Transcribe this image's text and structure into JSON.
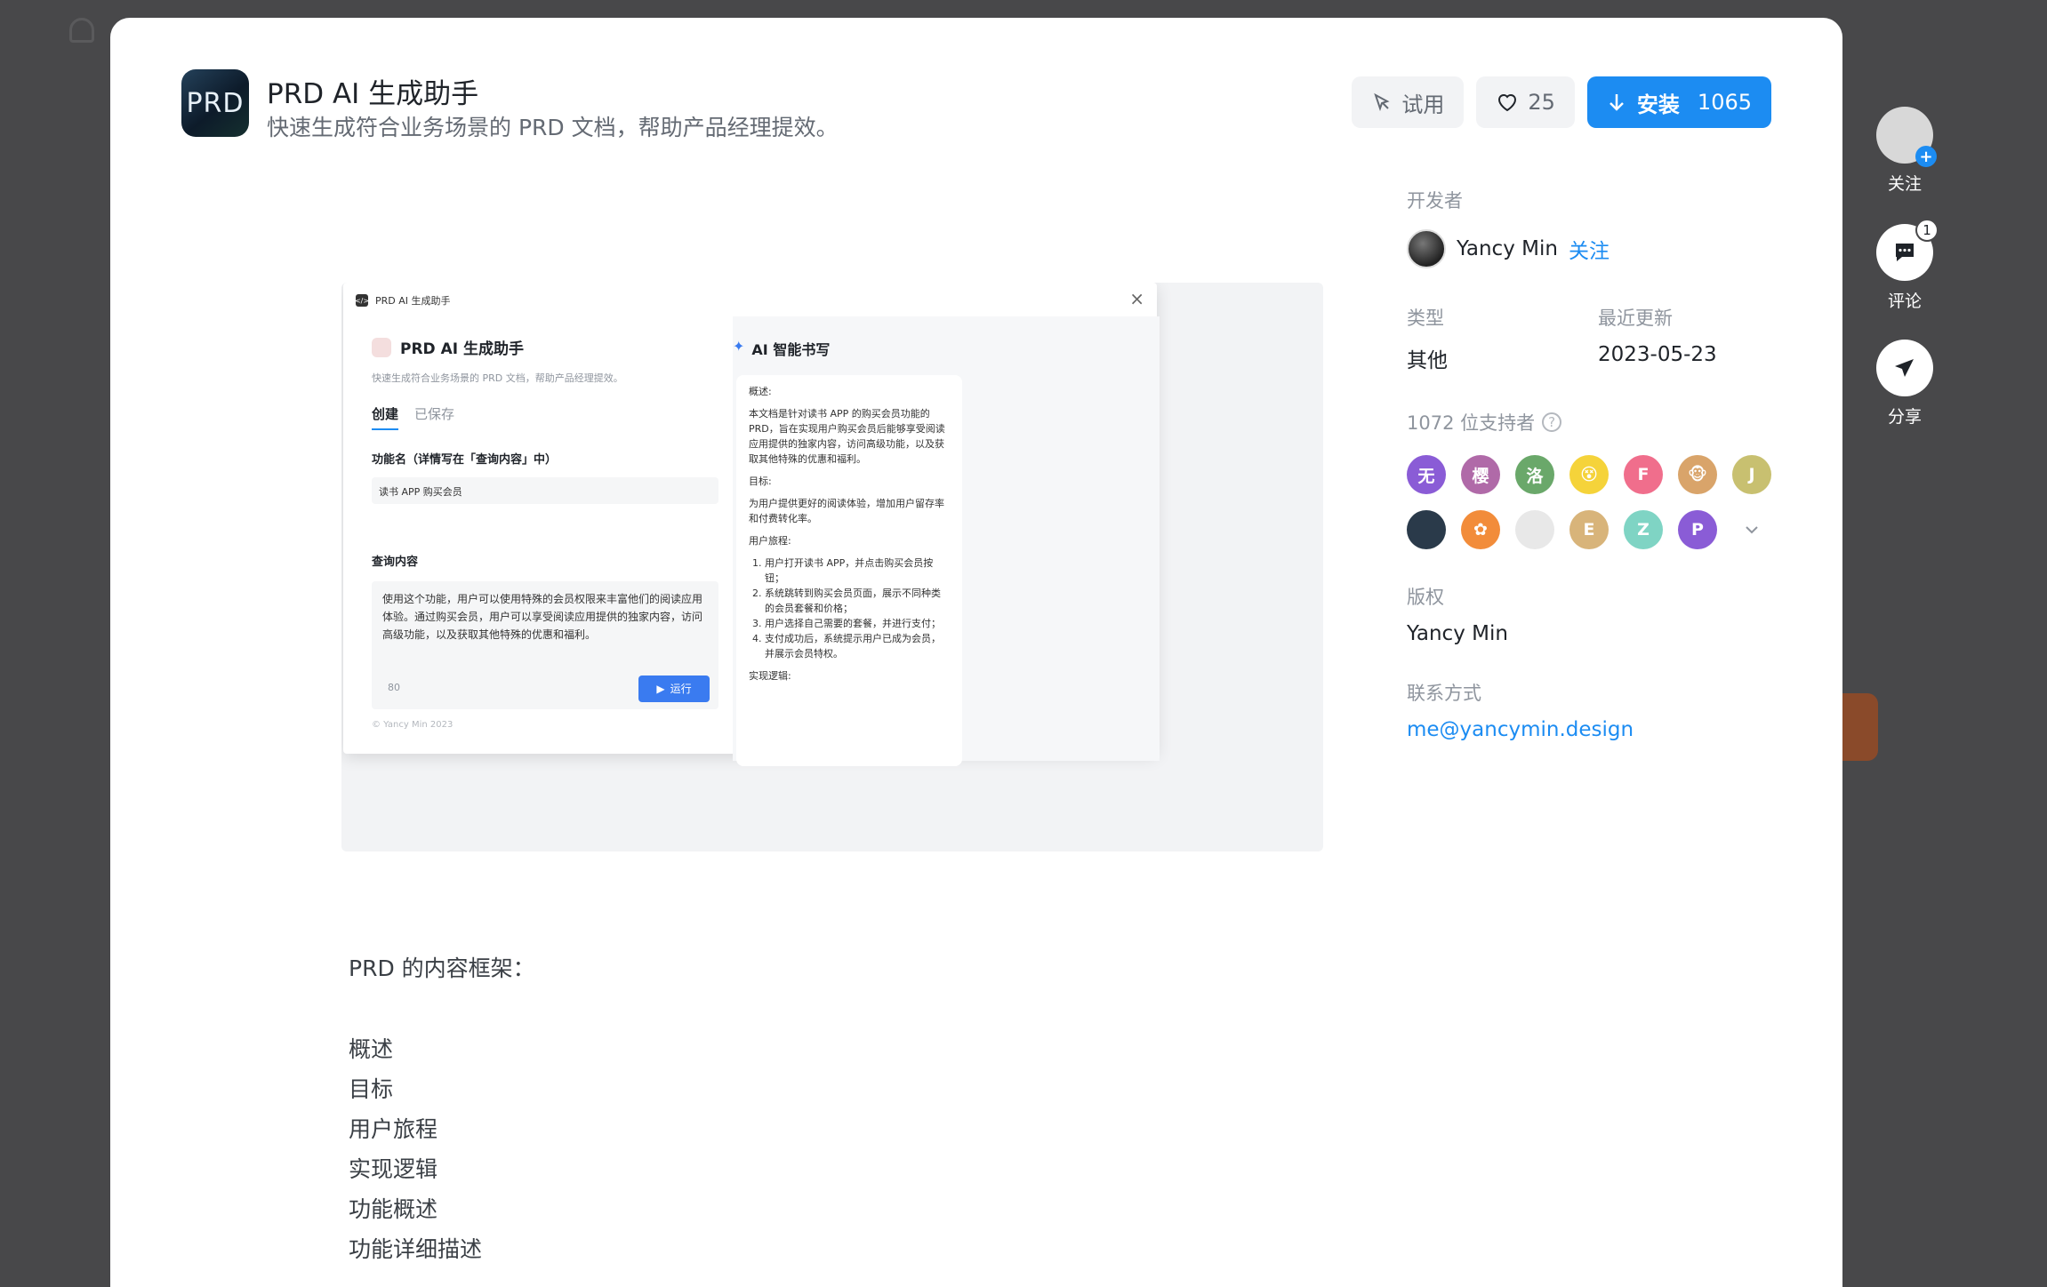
{
  "app": {
    "icon_text": "PRD",
    "title": "PRD AI 生成助手",
    "subtitle": "快速生成符合业务场景的 PRD 文档，帮助产品经理提效。"
  },
  "actions": {
    "try_label": "试用",
    "like_count": "25",
    "install_label": "安装",
    "install_count": "1065"
  },
  "info": {
    "developer_label": "开发者",
    "developer_name": "Yancy Min",
    "follow_label": "关注",
    "type_label": "类型",
    "type_value": "其他",
    "updated_label": "最近更新",
    "updated_value": "2023-05-23",
    "supporters_label": "1072 位支持者",
    "supporters": [
      {
        "initial": "无",
        "color": "#8a5cd6"
      },
      {
        "initial": "樱",
        "color": "#b06aa8"
      },
      {
        "initial": "洛",
        "color": "#6aa86a"
      },
      {
        "initial": "😵",
        "color": "#f5d33a"
      },
      {
        "initial": "F",
        "color": "#f06e8c"
      },
      {
        "initial": "🐵",
        "color": "#d9a46a"
      },
      {
        "initial": "J",
        "color": "#c8c070"
      },
      {
        "initial": "",
        "color": "#2a3a4a"
      },
      {
        "initial": "✿",
        "color": "#f28c3a"
      },
      {
        "initial": "",
        "color": "#e8e8e8"
      },
      {
        "initial": "E",
        "color": "#d8b47a"
      },
      {
        "initial": "Z",
        "color": "#7fd4c4"
      },
      {
        "initial": "P",
        "color": "#8a5cd6"
      }
    ],
    "copyright_label": "版权",
    "copyright_value": "Yancy Min",
    "contact_label": "联系方式",
    "contact_value": "me@yancymin.design"
  },
  "preview": {
    "window_title": "PRD AI 生成助手",
    "title": "PRD AI 生成助手",
    "subtitle": "快速生成符合业务场景的 PRD 文档，帮助产品经理提效。",
    "tab_create": "创建",
    "tab_saved": "已保存",
    "field1_label": "功能名（详情写在「查询内容」中）",
    "field1_value": "读书 APP 购买会员",
    "field2_label": "查询内容",
    "field2_value": "使用这个功能，用户可以使用特殊的会员权限来丰富他们的阅读应用体验。通过购买会员，用户可以享受阅读应用提供的独家内容，访问高级功能，以及获取其他特殊的优惠和福利。",
    "char_count": "80",
    "run_label": "运行",
    "footer": "© Yancy Min 2023",
    "ai_title": "AI 智能书写",
    "overview_h": "概述:",
    "overview": "本文档是针对读书 APP 的购买会员功能的PRD，旨在实现用户购买会员后能够享受阅读应用提供的独家内容，访问高级功能，以及获取其他特殊的优惠和福利。",
    "goal_h": "目标:",
    "goal": "为用户提供更好的阅读体验，增加用户留存率和付费转化率。",
    "journey_h": "用户旅程:",
    "journey": [
      "用户打开读书 APP，并点击购买会员按钮；",
      "系统跳转到购买会员页面，展示不同种类的会员套餐和价格；",
      "用户选择自己需要的套餐，并进行支付；",
      "支付成功后，系统提示用户已成为会员，并展示会员特权。"
    ],
    "logic_h": "实现逻辑:"
  },
  "content": {
    "intro": "PRD 的内容框架：",
    "items": [
      "概述",
      "目标",
      "用户旅程",
      "实现逻辑",
      "功能概述",
      "功能详细描述"
    ]
  },
  "side": {
    "follow": "关注",
    "comment": "评论",
    "comment_badge": "1",
    "share": "分享"
  }
}
